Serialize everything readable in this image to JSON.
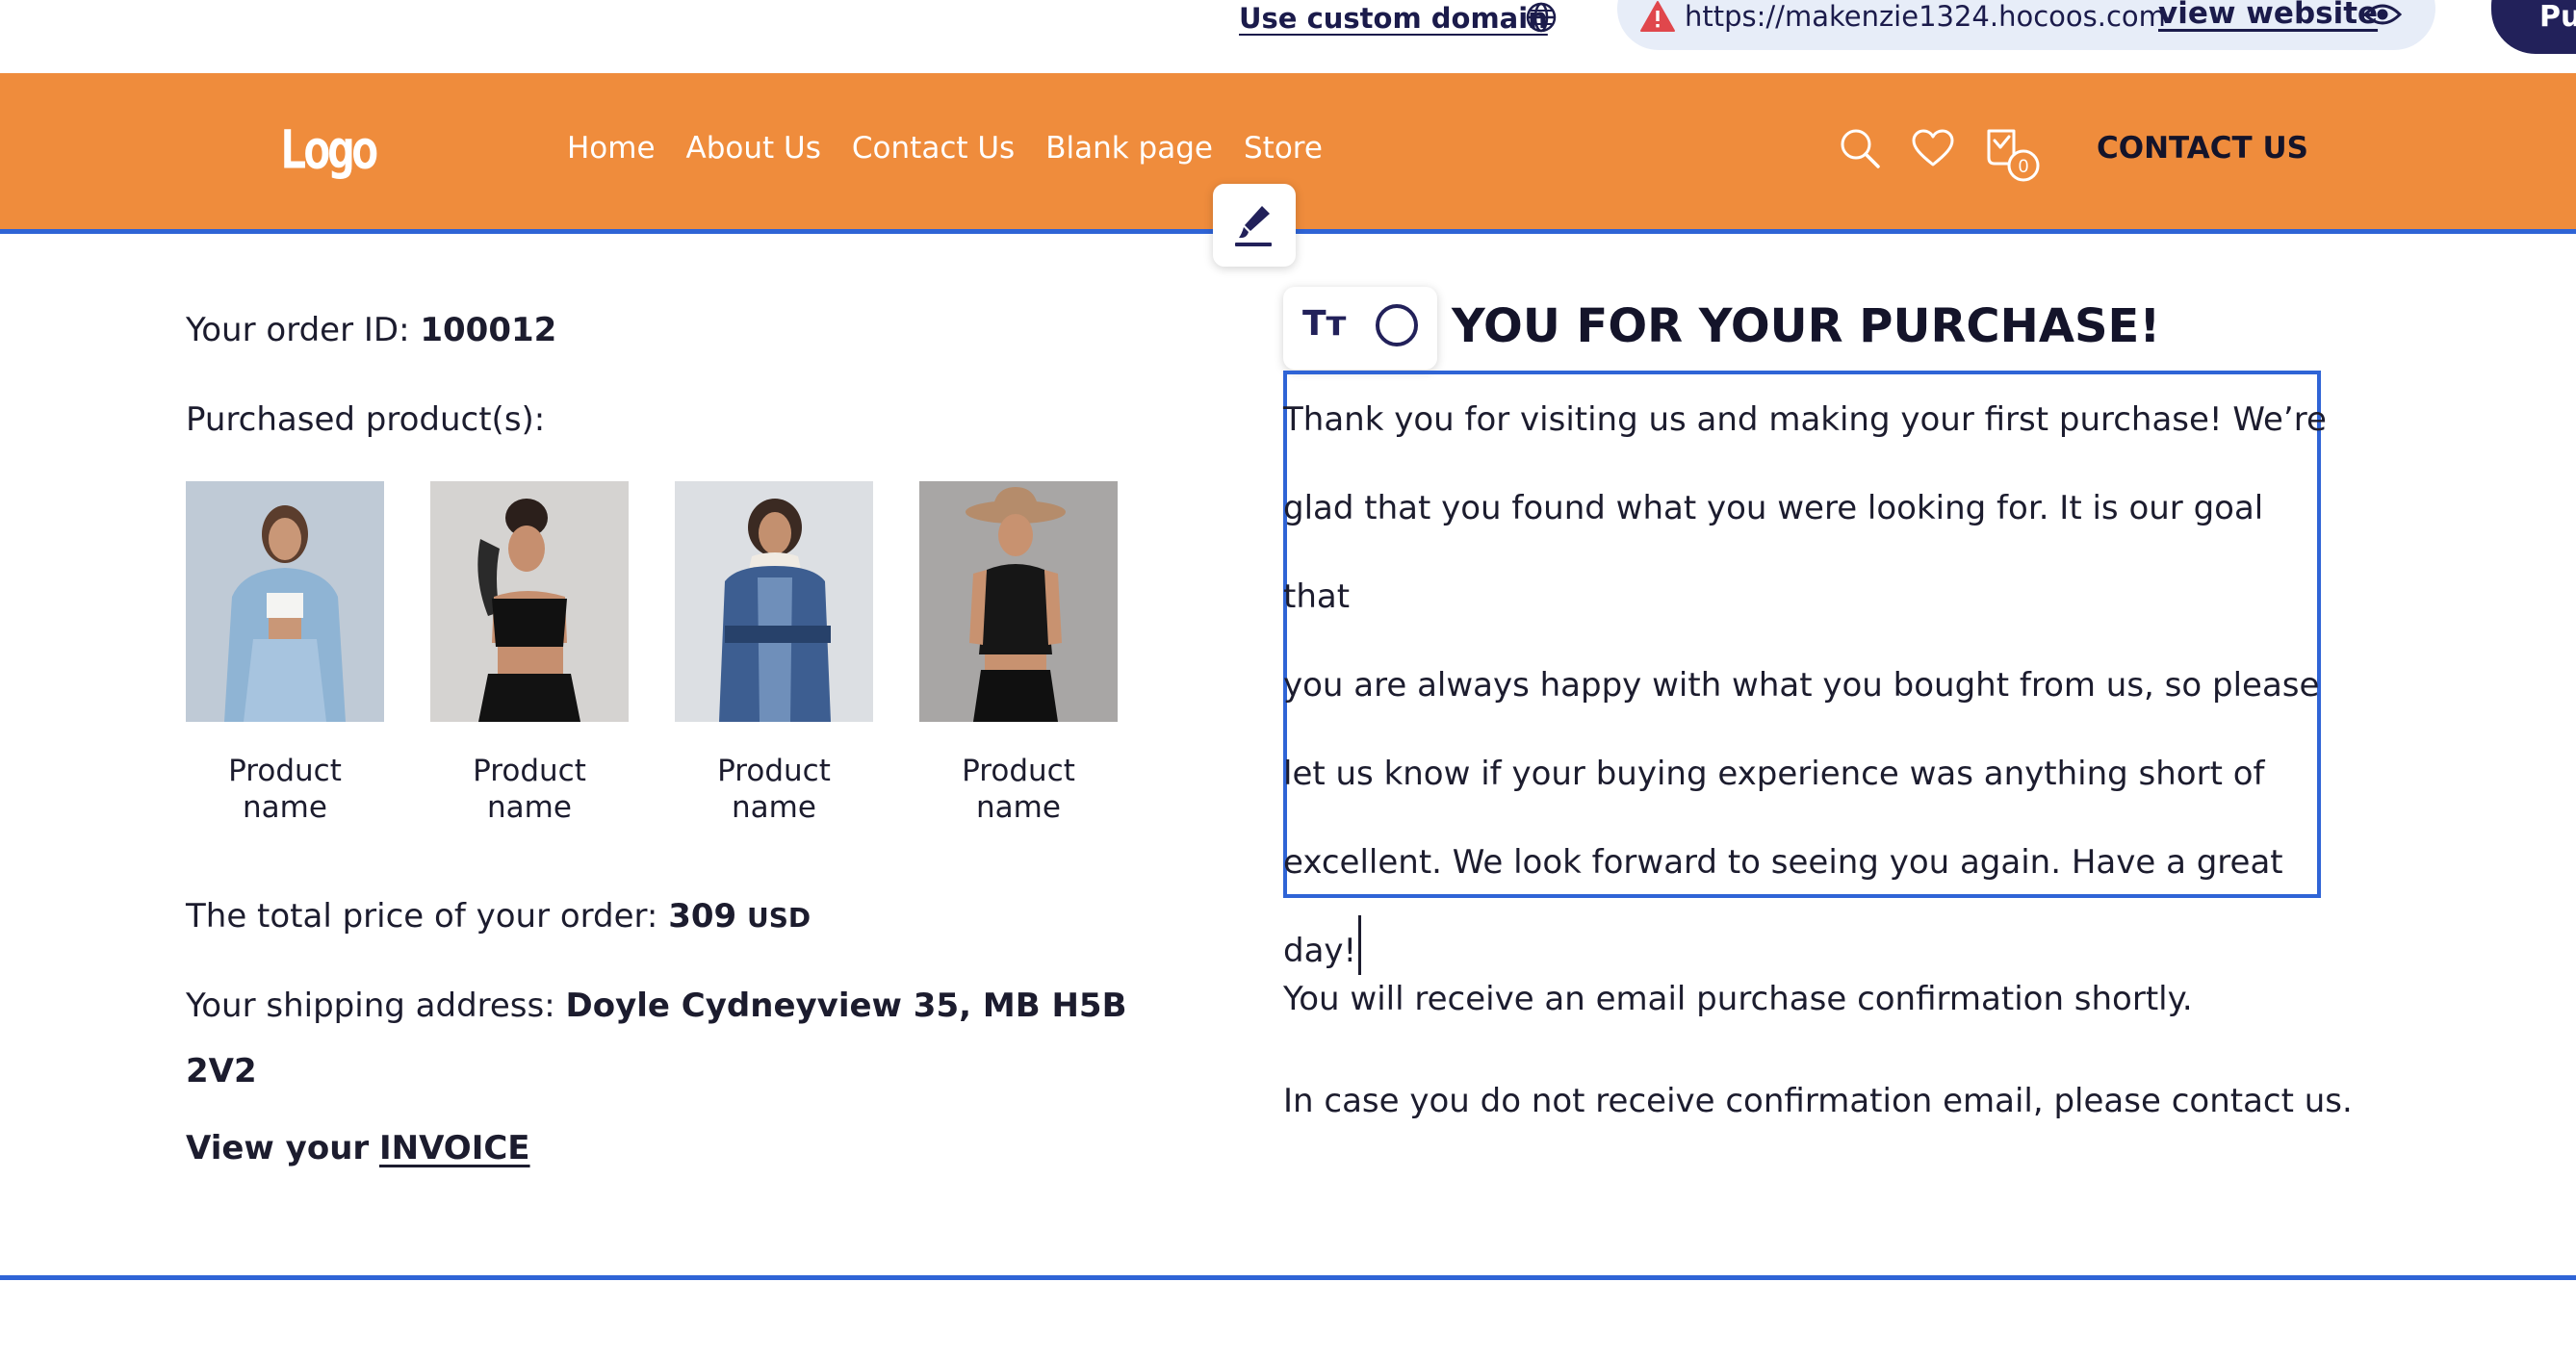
{
  "editor_bar": {
    "custom_domain_label": "Use custom domain",
    "site_url": "https://makenzie1324.hocoos.com",
    "view_website_label": "view website",
    "publish_label": "Pu"
  },
  "header": {
    "logo": "Logo",
    "nav": [
      "Home",
      "About Us",
      "Contact Us",
      "Blank page",
      "Store"
    ],
    "cart_count": "0",
    "contact_button": "CONTACT US"
  },
  "order": {
    "order_id_label": "Your order ID:",
    "order_id": "100012",
    "purchased_label": "Purchased product(s):",
    "products": [
      {
        "name_line1": "Product",
        "name_line2": "name"
      },
      {
        "name_line1": "Product",
        "name_line2": "name"
      },
      {
        "name_line1": "Product",
        "name_line2": "name"
      },
      {
        "name_line1": "Product",
        "name_line2": "name"
      }
    ],
    "total_label": "The total price of your order:",
    "total_value": "309",
    "currency": "USD",
    "shipping_label": "Your shipping address:",
    "shipping_line1": "Doyle Cydneyview 35, MB H5B",
    "shipping_line2": "2V2",
    "view_invoice_label": "View your",
    "invoice_link": "INVOICE"
  },
  "thanks": {
    "heading": "YOU FOR YOUR PURCHASE!",
    "text_toolbar_icon": "Tт",
    "lines": [
      "Thank you for visiting us and making your first purchase! We’re",
      "glad that you found what you were looking for. It is our goal that",
      "you are always happy with what you bought from us, so please",
      "let us know if your buying experience was anything short of",
      "excellent. We look forward to seeing you again. Have a great",
      "day!"
    ],
    "confirmation": "You will receive an email purchase confirmation shortly.",
    "contact_note": "In case you do not receive confirmation email, please contact us."
  },
  "colors": {
    "header_bg": "#ef8c3c",
    "accent_blue": "#2f64d6",
    "dark_navy": "#22215a",
    "url_pill_bg": "#e7edf8"
  },
  "icons": [
    "globe-icon",
    "warning-icon",
    "eye-icon",
    "search-icon",
    "heart-icon",
    "cart-icon",
    "brush-icon",
    "text-size-icon",
    "circle-icon"
  ]
}
